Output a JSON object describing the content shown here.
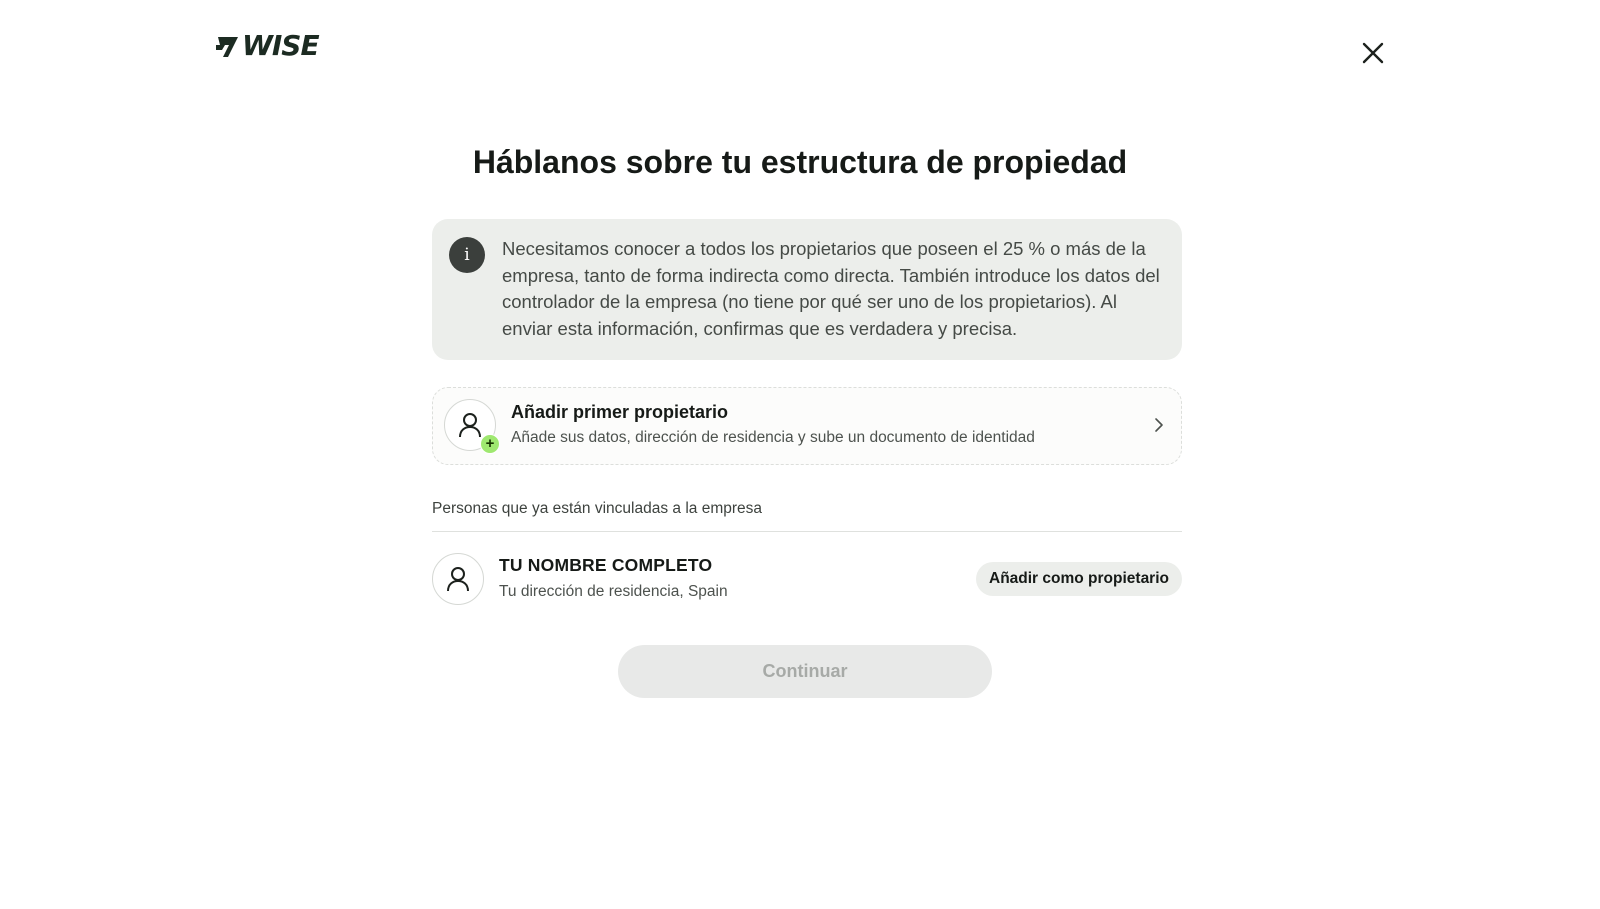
{
  "brand": {
    "name": "WISE",
    "logo_icon": "wise-flag-icon"
  },
  "header": {
    "close_icon": "close-icon",
    "close_label": "Cerrar"
  },
  "page": {
    "title": "Háblanos sobre tu estructura de propiedad"
  },
  "info": {
    "icon": "info-icon",
    "icon_glyph": "i",
    "text": "Necesitamos conocer a todos los propietarios que poseen el 25 % o más de la empresa, tanto de forma indirecta como directa. También introduce los datos del controlador de la empresa (no tiene por qué ser uno de los propietarios). Al enviar esta información, confirmas que es verdadera y precisa."
  },
  "add_owner": {
    "title": "Añadir primer propietario",
    "subtitle": "Añade sus datos, dirección de residencia y sube un documento de identidad",
    "badge_glyph": "+",
    "icon": "person-add-icon",
    "chevron_icon": "chevron-right-icon"
  },
  "linked_people": {
    "section_label": "Personas que ya están vinculadas a la empresa",
    "people": [
      {
        "name": "TU NOMBRE COMPLETO",
        "address": "Tu dirección de residencia, Spain",
        "action_label": "Añadir como propietario",
        "icon": "person-icon"
      }
    ]
  },
  "footer": {
    "continue_label": "Continuar",
    "continue_disabled": true
  },
  "colors": {
    "brand_dark": "#1c2b22",
    "accent_green": "#9fe870",
    "info_bg": "#eceeeb",
    "disabled_bg": "#e8e9e8",
    "disabled_text": "#a7aaa7"
  }
}
